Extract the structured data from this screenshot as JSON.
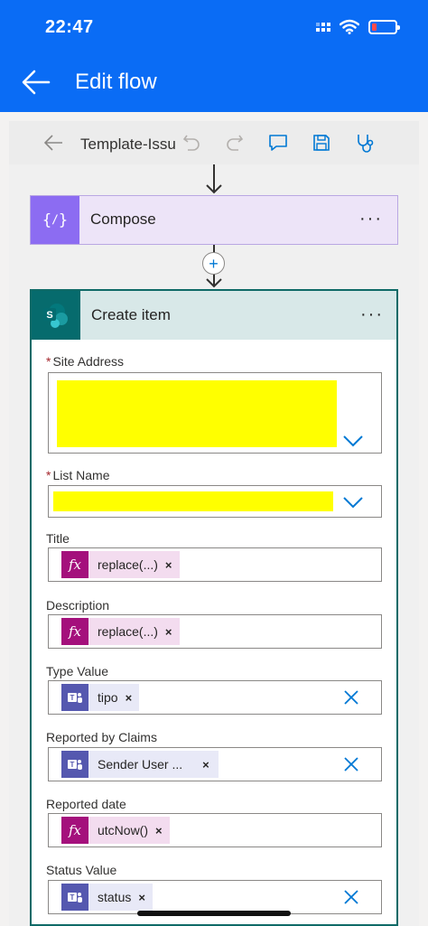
{
  "status": {
    "time": "22:47"
  },
  "header": {
    "title": "Edit flow"
  },
  "toolbar": {
    "flow_name": "Template-Issu"
  },
  "compose": {
    "title": "Compose",
    "icon": "curly-braces-icon",
    "more": "···"
  },
  "create_item": {
    "title": "Create item",
    "more": "···",
    "fields": {
      "site_address": {
        "label": "Site Address",
        "required_mark": "*"
      },
      "list_name": {
        "label": "List Name",
        "required_mark": "*"
      },
      "title": {
        "label": "Title",
        "token": "replace(...)",
        "token_type": "expression"
      },
      "description": {
        "label": "Description",
        "token": "replace(...)",
        "token_type": "expression"
      },
      "type_value": {
        "label": "Type Value",
        "token": "tipo",
        "token_type": "teams"
      },
      "reported_by": {
        "label": "Reported by Claims",
        "token": "Sender User ...",
        "token_type": "teams"
      },
      "reported_date": {
        "label": "Reported date",
        "token": "utcNow()",
        "token_type": "expression"
      },
      "status_value": {
        "label": "Status Value",
        "token": "status",
        "token_type": "teams"
      }
    }
  },
  "symbols": {
    "remove": "×",
    "plus": "+",
    "fx": "fx"
  },
  "colors": {
    "app_bar": "#0a6cf5",
    "compose_accent": "#8c6cf2",
    "sharepoint_accent": "#066b6d",
    "expression_token": "#a4107c",
    "teams_token": "#5558af",
    "redaction": "#ffff00"
  }
}
